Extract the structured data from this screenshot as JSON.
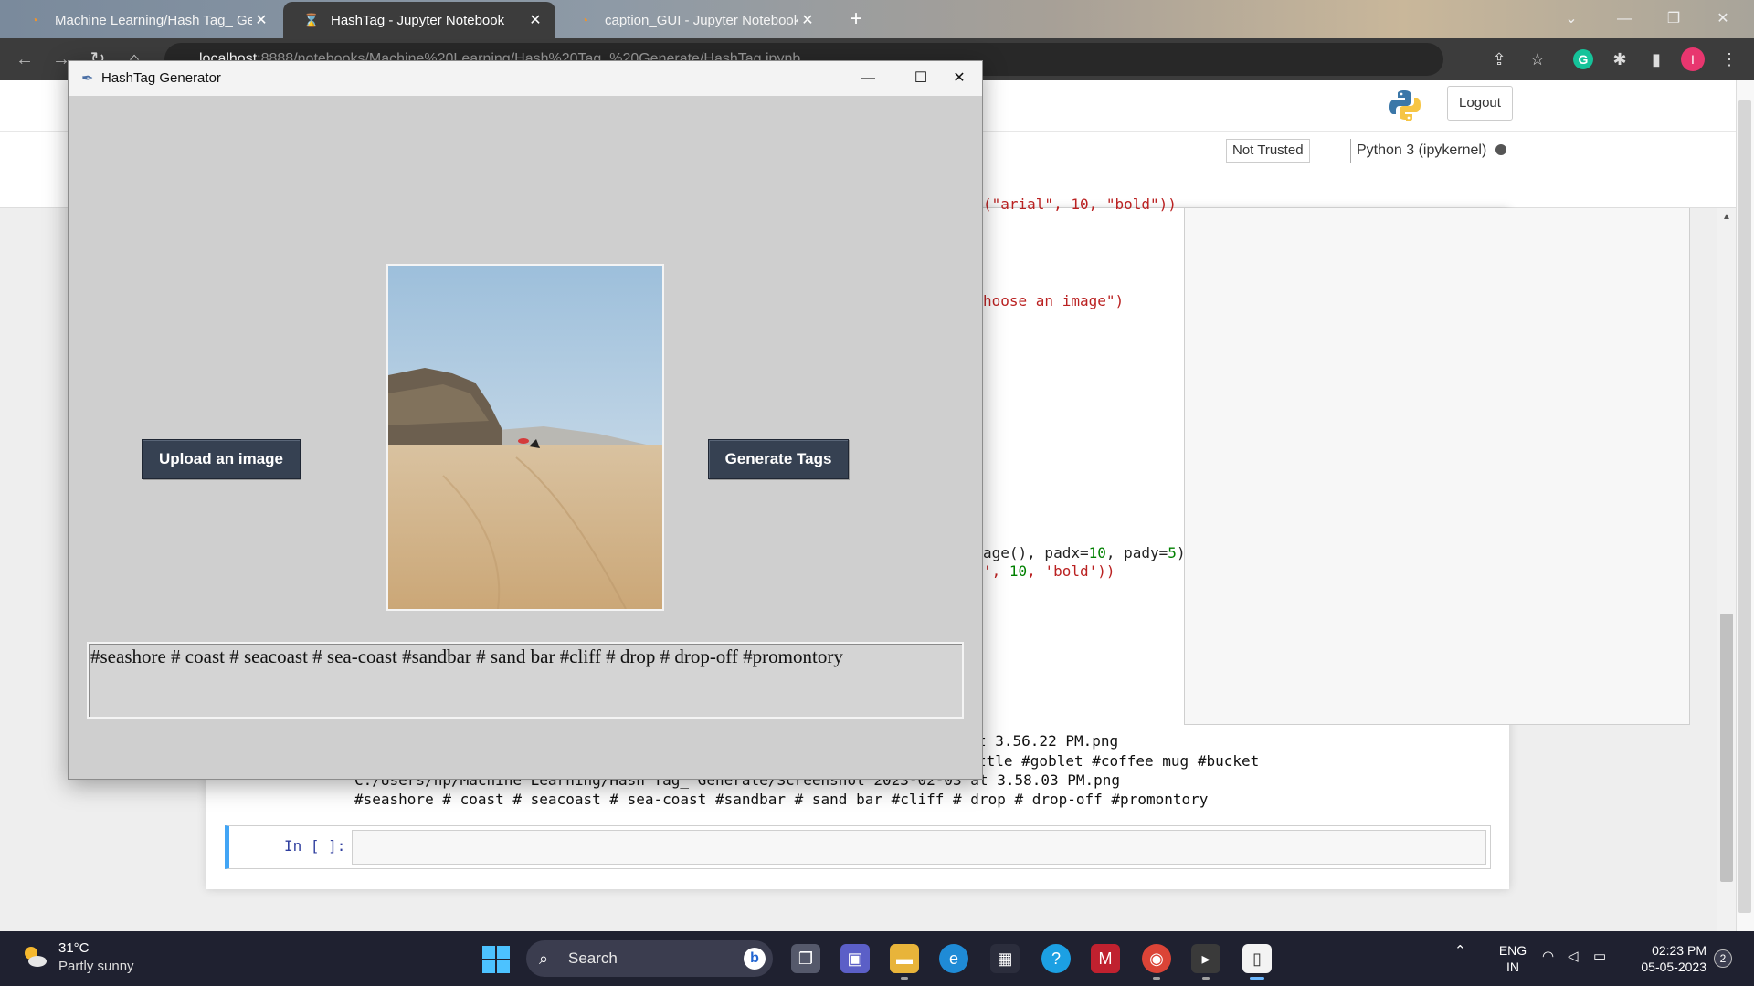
{
  "browser": {
    "tabs": [
      {
        "title": "Machine Learning/Hash Tag_ Ge",
        "icon": "jupyter-icon"
      },
      {
        "title": "HashTag - Jupyter Notebook",
        "icon": "hourglass-icon",
        "active": true
      },
      {
        "title": "caption_GUI - Jupyter Notebook",
        "icon": "jupyter-icon"
      }
    ],
    "url_host": "localhost",
    "url_path": ":8888/notebooks/Machine%20Learning/Hash%20Tag_%20Generate/HashTag.ipynb"
  },
  "jupyter": {
    "logout_label": "Logout",
    "trust_status": "Not Trusted",
    "kernel_name": "Python 3 (ipykernel)",
    "code_fragments": {
      "line1_a": "(\"arial\", 10, \"bold\"))",
      "line2_a": "hoose an image\")",
      "line3_a": "age(), padx=",
      "line3_b": "10",
      "line3_c": ", pady=",
      "line3_d": "5",
      "line3_e": ")",
      "line4_a": "', ",
      "line4_b": "10",
      "line4_c": ", 'bold'))"
    },
    "output_lines": [
      "t 3.56.22 PM.png",
      "ttle #goblet #coffee mug #bucket",
      "C:/Users/hp/Machine Learning/Hash Tag_ Generate/Screenshot 2023-02-03 at 3.58.03 PM.png",
      "#seashore # coast # seacoast # sea-coast #sandbar # sand bar #cliff # drop # drop-off #promontory"
    ],
    "input_prompt": "In [ ]:"
  },
  "app": {
    "window_title": "HashTag Generator",
    "upload_label": "Upload an image",
    "generate_label": "Generate Tags",
    "tags_text": "#seashore # coast # seacoast # sea-coast #sandbar # sand bar #cliff # drop # drop-off #promontory",
    "button_color": "#364152",
    "window_bg": "#cfcfcf"
  },
  "taskbar": {
    "weather_temp": "31°C",
    "weather_desc": "Partly sunny",
    "search_placeholder": "Search",
    "lang_primary": "ENG",
    "lang_secondary": "IN",
    "time": "02:23 PM",
    "date": "05-05-2023",
    "notification_count": "2"
  }
}
